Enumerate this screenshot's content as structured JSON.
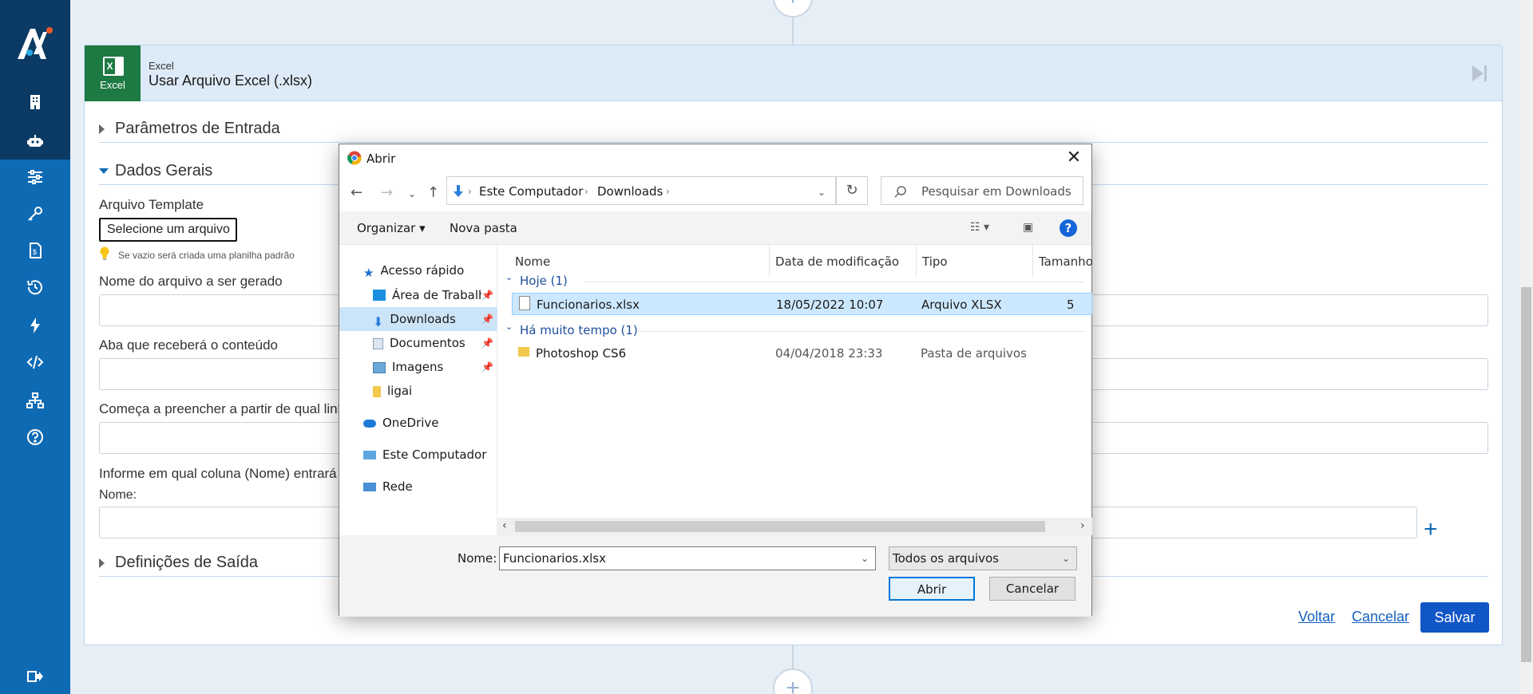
{
  "app": {
    "sidebar": {
      "items": [
        "building-icon",
        "robot-icon",
        "sliders-icon",
        "key-icon",
        "invoice-icon",
        "history-icon",
        "lightning-icon",
        "code-icon",
        "network-icon",
        "help-circle-icon",
        "logout-icon"
      ]
    },
    "colors": {
      "sidebar": "#0f6ab4",
      "sidebar_dark": "#0b3b64",
      "primary": "#1156c7",
      "excel": "#1d7a43"
    }
  },
  "card": {
    "kind": "Excel",
    "title": "Usar Arquivo Excel (.xlsx)",
    "badge_label": "Excel",
    "sections": {
      "params": "Parâmetros de Entrada",
      "general": "Dados Gerais",
      "output": "Definições de Saída"
    },
    "fields": {
      "template_label": "Arquivo Template",
      "template_button": "Selecione um arquivo",
      "template_hint": "Se vazio será criada uma planilha padrão",
      "filename_label": "Nome do arquivo a ser gerado",
      "sheet_label": "Aba que receberá o conteúdo",
      "start_row_label": "Começa a preencher a partir de qual linha",
      "column_label": "Informe em qual coluna (Nome) entrará o",
      "name_label": "Nome:"
    },
    "actions": {
      "back": "Voltar",
      "cancel": "Cancelar",
      "save": "Salvar"
    }
  },
  "dialog": {
    "title": "Abrir",
    "address": {
      "computer": "Este Computador",
      "folder": "Downloads"
    },
    "search_placeholder": "Pesquisar em Downloads",
    "toolbar": {
      "organize": "Organizar",
      "new_folder": "Nova pasta"
    },
    "nav": {
      "quick_access": "Acesso rápido",
      "desktop": "Área de Trabalho",
      "downloads": "Downloads",
      "documents": "Documentos",
      "images": "Imagens",
      "ligai": "ligai",
      "onedrive": "OneDrive",
      "this_pc": "Este Computador",
      "network": "Rede"
    },
    "columns": {
      "name": "Nome",
      "modified": "Data de modificação",
      "type": "Tipo",
      "size": "Tamanho"
    },
    "groups": [
      {
        "label": "Hoje (1)",
        "files": [
          {
            "name": "Funcionarios.xlsx",
            "modified": "18/05/2022 10:07",
            "type": "Arquivo XLSX",
            "size": "5"
          }
        ]
      },
      {
        "label": "Há muito tempo (1)",
        "files": [
          {
            "name": "Photoshop CS6",
            "modified": "04/04/2018 23:33",
            "type": "Pasta de arquivos",
            "size": ""
          }
        ]
      }
    ],
    "filename_label": "Nome:",
    "filename_value": "Funcionarios.xlsx",
    "filter_value": "Todos os arquivos",
    "open_button": "Abrir",
    "cancel_button": "Cancelar"
  }
}
